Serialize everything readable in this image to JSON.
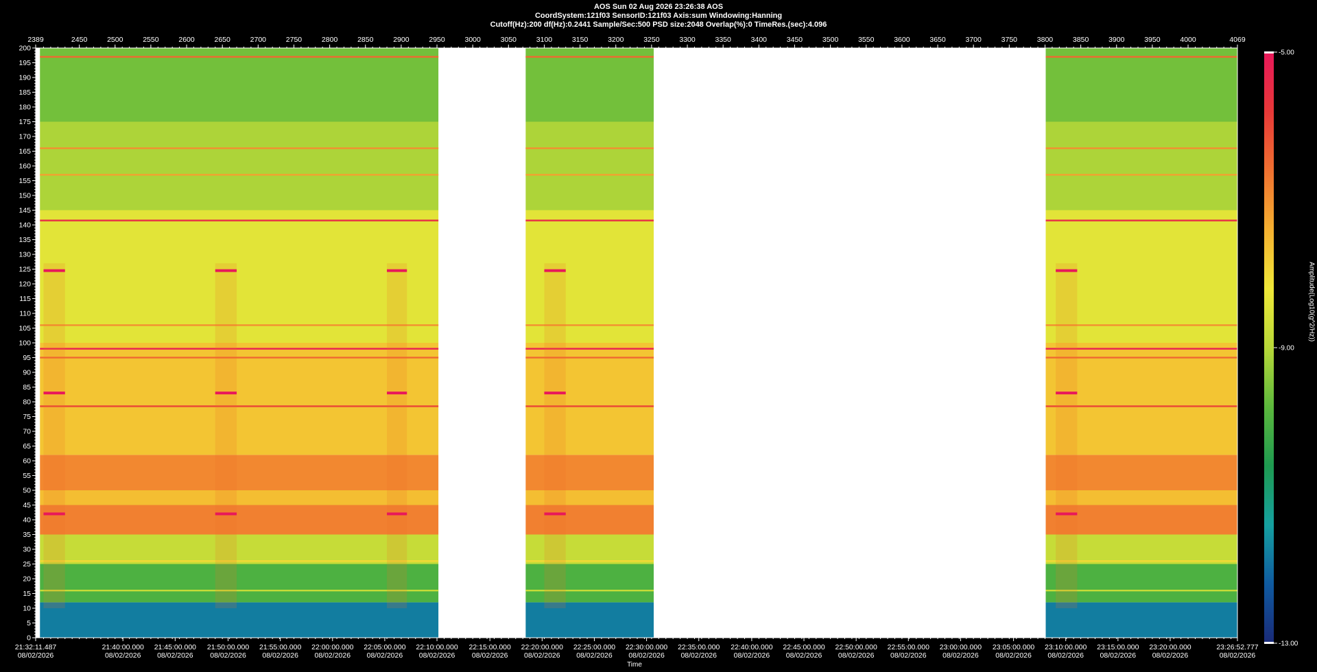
{
  "header": {
    "line1": "AOS  Sun 02 Aug 2026 23:26:38  AOS",
    "line2": "CoordSystem:121f03   SensorID:121f03    Axis:sum    Windowing:Hanning",
    "line3": "Cutoff(Hz):200        df(Hz):0.2441       Sample/Sec:500        PSD size:2048          Overlap(%):0           TimeRes.(sec):4.096"
  },
  "colorbar": {
    "label": "Amplitude(Log10(g^2/Hz))",
    "max_label": "-5.00",
    "mid_label": "-9.00",
    "min_label": "-13.00",
    "colors": [
      "#1a2a78",
      "#0f5aa0",
      "#15a0a0",
      "#1e9a50",
      "#5cb83c",
      "#b8d838",
      "#f0e838",
      "#f5b030",
      "#f07030",
      "#e83838",
      "#e8185a"
    ]
  },
  "chart_data": {
    "type": "heatmap",
    "title": "",
    "xlabel": "Time",
    "ylabel": "",
    "ylim": [
      0,
      200
    ],
    "xlim_index": [
      2389,
      4069
    ],
    "zlim": [
      -13.0,
      -5.0
    ],
    "y_ticks": [
      0,
      5,
      10,
      15,
      20,
      25,
      30,
      35,
      40,
      45,
      50,
      55,
      60,
      65,
      70,
      75,
      80,
      85,
      90,
      95,
      100,
      105,
      110,
      115,
      120,
      125,
      130,
      135,
      140,
      145,
      150,
      155,
      160,
      165,
      170,
      175,
      180,
      185,
      190,
      195,
      200
    ],
    "top_ticks": [
      2389,
      2450,
      2500,
      2550,
      2600,
      2650,
      2700,
      2750,
      2800,
      2850,
      2900,
      2950,
      3000,
      3050,
      3100,
      3150,
      3200,
      3250,
      3300,
      3350,
      3400,
      3450,
      3500,
      3550,
      3600,
      3650,
      3700,
      3750,
      3800,
      3850,
      3900,
      3950,
      4000,
      4069
    ],
    "time_ticks": [
      {
        "index": 2389,
        "time": "21:32:11.487",
        "date": "08/02/2026"
      },
      {
        "index": 2511,
        "time": "21:40:00.000",
        "date": "08/02/2026"
      },
      {
        "index": 2584,
        "time": "21:45:00.000",
        "date": "08/02/2026"
      },
      {
        "index": 2658,
        "time": "21:50:00.000",
        "date": "08/02/2026"
      },
      {
        "index": 2731,
        "time": "21:55:00.000",
        "date": "08/02/2026"
      },
      {
        "index": 2804,
        "time": "22:00:00.000",
        "date": "08/02/2026"
      },
      {
        "index": 2877,
        "time": "22:05:00.000",
        "date": "08/02/2026"
      },
      {
        "index": 2950,
        "time": "22:10:00.000",
        "date": "08/02/2026"
      },
      {
        "index": 3024,
        "time": "22:15:00.000",
        "date": "08/02/2026"
      },
      {
        "index": 3097,
        "time": "22:20:00.000",
        "date": "08/02/2026"
      },
      {
        "index": 3170,
        "time": "22:25:00.000",
        "date": "08/02/2026"
      },
      {
        "index": 3243,
        "time": "22:30:00.000",
        "date": "08/02/2026"
      },
      {
        "index": 3316,
        "time": "22:35:00.000",
        "date": "08/02/2026"
      },
      {
        "index": 3390,
        "time": "22:40:00.000",
        "date": "08/02/2026"
      },
      {
        "index": 3463,
        "time": "22:45:00.000",
        "date": "08/02/2026"
      },
      {
        "index": 3536,
        "time": "22:50:00.000",
        "date": "08/02/2026"
      },
      {
        "index": 3609,
        "time": "22:55:00.000",
        "date": "08/02/2026"
      },
      {
        "index": 3682,
        "time": "23:00:00.000",
        "date": "08/02/2026"
      },
      {
        "index": 3756,
        "time": "23:05:00.000",
        "date": "08/02/2026"
      },
      {
        "index": 3829,
        "time": "23:10:00.000",
        "date": "08/02/2026"
      },
      {
        "index": 3902,
        "time": "23:15:00.000",
        "date": "08/02/2026"
      },
      {
        "index": 3975,
        "time": "23:20:00.000",
        "date": "08/02/2026"
      },
      {
        "index": 4069,
        "time": "23:26:52.777",
        "date": "08/02/2026"
      }
    ],
    "data_segments": [
      [
        2395,
        2952
      ],
      [
        3074,
        3253
      ],
      [
        3801,
        4069
      ]
    ],
    "gap_segments": [
      [
        2952,
        3074
      ],
      [
        3253,
        3801
      ]
    ],
    "event_columns": [
      [
        2400,
        2430
      ],
      [
        2640,
        2670
      ],
      [
        2880,
        2908
      ],
      [
        3100,
        3130
      ],
      [
        3815,
        3845
      ]
    ],
    "frequency_bands": [
      {
        "hz_from": 0,
        "hz_to": 12,
        "level": -11.8,
        "note": "low-frequency blue/teal floor"
      },
      {
        "hz_from": 12,
        "hz_to": 25,
        "level": -10.0
      },
      {
        "hz_from": 25,
        "hz_to": 35,
        "level": -8.8
      },
      {
        "hz_from": 35,
        "hz_to": 45,
        "level": -6.8
      },
      {
        "hz_from": 45,
        "hz_to": 50,
        "level": -7.6
      },
      {
        "hz_from": 50,
        "hz_to": 62,
        "level": -6.9
      },
      {
        "hz_from": 62,
        "hz_to": 100,
        "level": -7.7
      },
      {
        "hz_from": 100,
        "hz_to": 145,
        "level": -8.4
      },
      {
        "hz_from": 145,
        "hz_to": 175,
        "level": -9.1
      },
      {
        "hz_from": 175,
        "hz_to": 200,
        "level": -9.6
      }
    ],
    "tonal_lines_hz": [
      {
        "hz": 197,
        "level": -6.5
      },
      {
        "hz": 166,
        "level": -7.0
      },
      {
        "hz": 157,
        "level": -7.2
      },
      {
        "hz": 141.5,
        "level": -5.5
      },
      {
        "hz": 106,
        "level": -7.0
      },
      {
        "hz": 98,
        "level": -5.2
      },
      {
        "hz": 95,
        "level": -6.5
      },
      {
        "hz": 78.5,
        "level": -6.0
      },
      {
        "hz": 26,
        "level": -8.0
      },
      {
        "hz": 16,
        "level": -8.8
      }
    ],
    "event_markers_hz": [
      {
        "hz": 124.5,
        "level": -5.0
      },
      {
        "hz": 83,
        "level": -5.0
      },
      {
        "hz": 42,
        "level": -5.0
      }
    ]
  }
}
